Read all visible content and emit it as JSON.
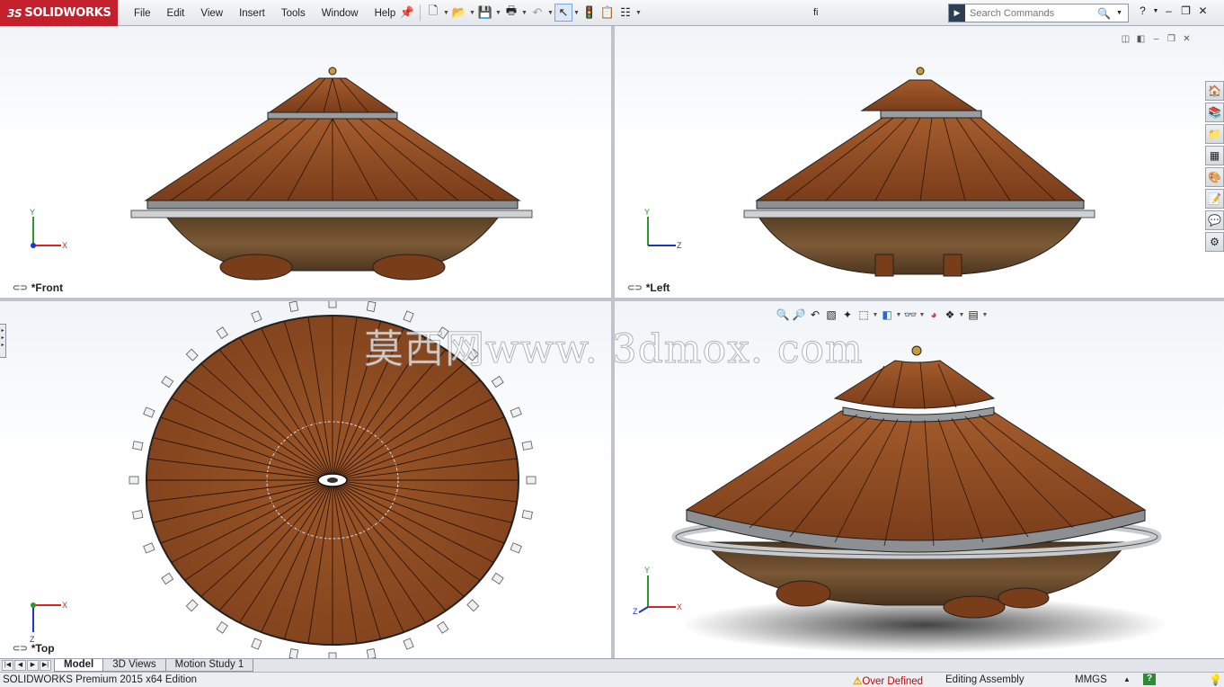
{
  "app": {
    "brand": "SOLIDWORKS",
    "brand_mark": "3S",
    "document_title": "fi"
  },
  "menu": [
    "File",
    "Edit",
    "View",
    "Insert",
    "Tools",
    "Window",
    "Help"
  ],
  "search": {
    "placeholder": "Search Commands"
  },
  "viewports": {
    "front": {
      "label": "*Front",
      "triad": [
        "Y",
        "X"
      ]
    },
    "left": {
      "label": "*Left",
      "triad": [
        "Y",
        "Z"
      ]
    },
    "top": {
      "label": "*Top",
      "triad": [
        "X",
        "Z"
      ]
    },
    "iso": {
      "triad": [
        "Y",
        "X",
        "Z"
      ]
    }
  },
  "watermark": "莫西网www. 3dmox. com",
  "tabs": [
    {
      "label": "Model",
      "active": true
    },
    {
      "label": "3D Views",
      "active": false
    },
    {
      "label": "Motion Study 1",
      "active": false
    }
  ],
  "status": {
    "product": "SOLIDWORKS Premium 2015 x64 Edition",
    "warning": "Over Defined",
    "mode": "Editing Assembly",
    "units": "MMGS"
  },
  "colors": {
    "brand_red": "#c3202b",
    "wood": "#8a4a22",
    "hull": "#6b4a2a",
    "warning": "#cc0000"
  }
}
